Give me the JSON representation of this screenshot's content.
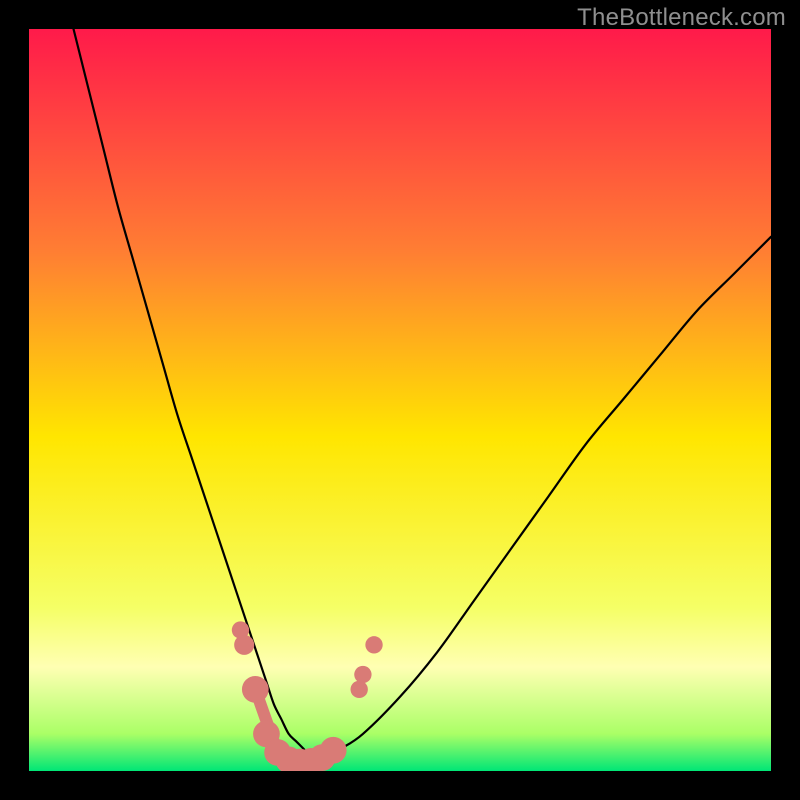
{
  "watermark": "TheBottleneck.com",
  "colors": {
    "frame": "#000000",
    "gradient_top": "#ff1a4a",
    "gradient_q1": "#ff7e33",
    "gradient_mid": "#ffe600",
    "gradient_q3": "#f5ff66",
    "gradient_band": "#ffffb3",
    "gradient_bottom": "#00e676",
    "curve": "#000000",
    "markers": "#d97b76"
  },
  "chart_data": {
    "type": "line",
    "title": "",
    "xlabel": "",
    "ylabel": "",
    "xlim": [
      0,
      100
    ],
    "ylim": [
      0,
      100
    ],
    "series": [
      {
        "name": "bottleneck-curve",
        "x": [
          6,
          8,
          10,
          12,
          14,
          16,
          18,
          20,
          22,
          24,
          26,
          28,
          30,
          31,
          32,
          33,
          34,
          35,
          36,
          37,
          38,
          40,
          42,
          45,
          50,
          55,
          60,
          65,
          70,
          75,
          80,
          85,
          90,
          95,
          100
        ],
        "y": [
          100,
          92,
          84,
          76,
          69,
          62,
          55,
          48,
          42,
          36,
          30,
          24,
          18,
          15,
          12,
          9,
          7,
          5,
          4,
          3,
          2,
          2,
          3,
          5,
          10,
          16,
          23,
          30,
          37,
          44,
          50,
          56,
          62,
          67,
          72
        ]
      }
    ],
    "markers": [
      {
        "x": 28.5,
        "y": 19,
        "r": 1.3
      },
      {
        "x": 29.0,
        "y": 17,
        "r": 1.5
      },
      {
        "x": 30.5,
        "y": 11,
        "r": 2.0
      },
      {
        "x": 32.0,
        "y": 5,
        "r": 2.0
      },
      {
        "x": 33.5,
        "y": 2.5,
        "r": 2.0
      },
      {
        "x": 35.0,
        "y": 1.5,
        "r": 2.0
      },
      {
        "x": 36.5,
        "y": 1.2,
        "r": 2.0
      },
      {
        "x": 38.0,
        "y": 1.3,
        "r": 2.0
      },
      {
        "x": 39.5,
        "y": 1.8,
        "r": 2.0
      },
      {
        "x": 41.0,
        "y": 2.8,
        "r": 2.0
      },
      {
        "x": 44.5,
        "y": 11,
        "r": 1.3
      },
      {
        "x": 45.0,
        "y": 13,
        "r": 1.3
      },
      {
        "x": 46.5,
        "y": 17,
        "r": 1.3
      }
    ],
    "connector": [
      {
        "x": 30.5,
        "y": 11
      },
      {
        "x": 33.5,
        "y": 2.5
      },
      {
        "x": 36.5,
        "y": 1.2
      },
      {
        "x": 39.5,
        "y": 1.8
      },
      {
        "x": 41.0,
        "y": 2.8
      }
    ]
  }
}
